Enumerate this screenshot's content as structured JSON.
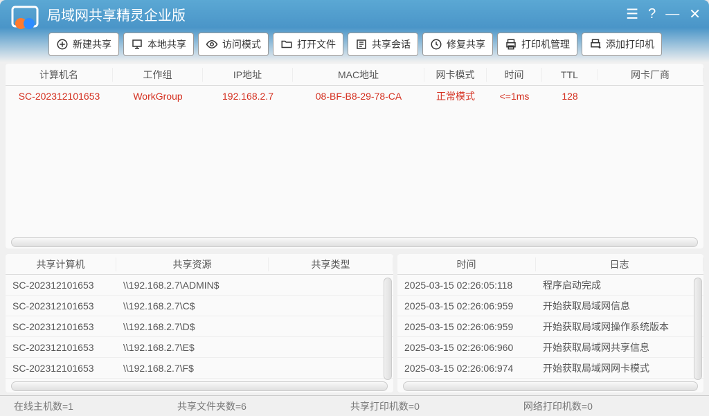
{
  "app_title": "局域网共享精灵企业版",
  "toolbar": {
    "new_share": "新建共享",
    "local_share": "本地共享",
    "access_mode": "访问模式",
    "open_file": "打开文件",
    "share_session": "共享会话",
    "repair_share": "修复共享",
    "printer_mgmt": "打印机管理",
    "add_printer": "添加打印机"
  },
  "hosts_header": {
    "name": "计算机名",
    "workgroup": "工作组",
    "ip": "IP地址",
    "mac": "MAC地址",
    "nic_mode": "网卡模式",
    "time": "时间",
    "ttl": "TTL",
    "vendor": "网卡厂商"
  },
  "hosts": [
    {
      "name": "SC-202312101653",
      "workgroup": "WorkGroup",
      "ip": "192.168.2.7",
      "mac": "08-BF-B8-29-78-CA",
      "nic_mode": "正常模式",
      "time": "<=1ms",
      "ttl": "128",
      "vendor": ""
    }
  ],
  "shares_header": {
    "computer": "共享计算机",
    "resource": "共享资源",
    "type": "共享类型"
  },
  "shares": [
    {
      "computer": "SC-202312101653",
      "resource": "\\\\192.168.2.7\\ADMIN$",
      "type": ""
    },
    {
      "computer": "SC-202312101653",
      "resource": "\\\\192.168.2.7\\C$",
      "type": ""
    },
    {
      "computer": "SC-202312101653",
      "resource": "\\\\192.168.2.7\\D$",
      "type": ""
    },
    {
      "computer": "SC-202312101653",
      "resource": "\\\\192.168.2.7\\E$",
      "type": ""
    },
    {
      "computer": "SC-202312101653",
      "resource": "\\\\192.168.2.7\\F$",
      "type": ""
    }
  ],
  "log_header": {
    "time": "时间",
    "log": "日志"
  },
  "logs": [
    {
      "time": "2025-03-15 02:26:05:118",
      "log": "程序启动完成"
    },
    {
      "time": "2025-03-15 02:26:06:959",
      "log": "开始获取局域网信息"
    },
    {
      "time": "2025-03-15 02:26:06:959",
      "log": "开始获取局域网操作系统版本"
    },
    {
      "time": "2025-03-15 02:26:06:960",
      "log": "开始获取局域网共享信息"
    },
    {
      "time": "2025-03-15 02:26:06:974",
      "log": "开始获取局域网网卡模式"
    }
  ],
  "status": {
    "online_hosts": "在线主机数=1",
    "share_folders": "共享文件夹数=6",
    "share_printers": "共享打印机数=0",
    "net_printers": "网络打印机数=0"
  }
}
